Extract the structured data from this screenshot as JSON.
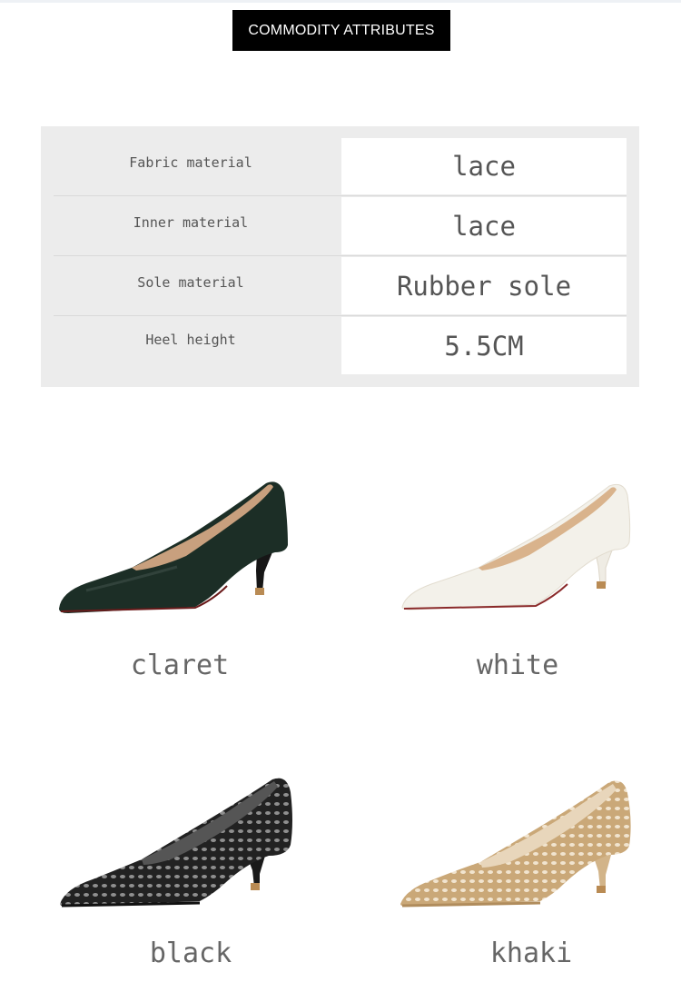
{
  "banner": {
    "title": "COMMODITY ATTRIBUTES"
  },
  "attributes": [
    {
      "label": "Fabric material",
      "value": "lace"
    },
    {
      "label": "Inner material",
      "value": "lace"
    },
    {
      "label": "Sole material",
      "value": "Rubber sole"
    },
    {
      "label": "Heel height",
      "value": "5.5CM"
    }
  ],
  "variants": [
    {
      "name": "claret",
      "upper": "#1c2e26",
      "style": "satin"
    },
    {
      "name": "white",
      "upper": "#f3f1ea",
      "style": "leather"
    },
    {
      "name": "black",
      "upper": "#151515",
      "style": "lace"
    },
    {
      "name": "khaki",
      "upper": "#d2b489",
      "style": "lace"
    }
  ]
}
